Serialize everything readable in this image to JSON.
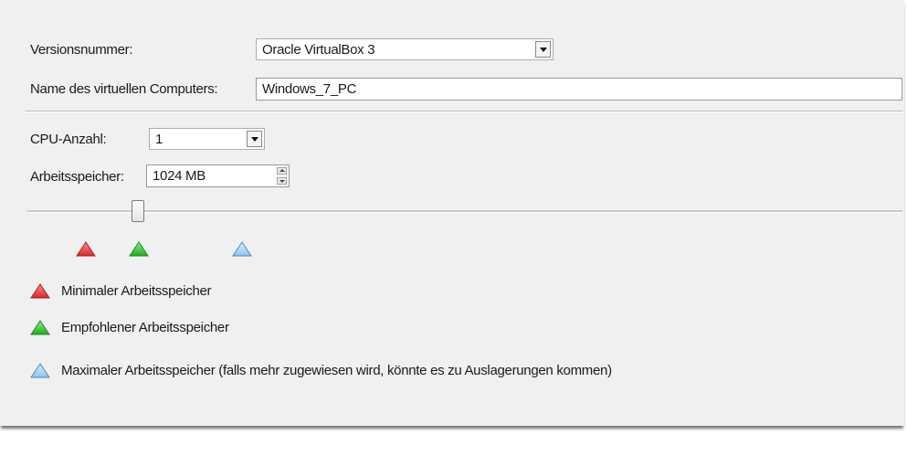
{
  "general": {
    "version_label": "Versionsnummer:",
    "version_value": "Oracle VirtualBox 3",
    "name_label": "Name des virtuellen Computers:",
    "name_value": "Windows_7_PC"
  },
  "hardware": {
    "cpu_label": "CPU-Anzahl:",
    "cpu_value": "1",
    "memory_label": "Arbeitsspeicher:",
    "memory_value": "1024 MB"
  },
  "legend": {
    "min_label": "Minimaler Arbeitsspeicher",
    "recommended_label": "Empfohlener Arbeitsspeicher",
    "max_label": "Maximaler Arbeitsspeicher (falls mehr zugewiesen wird, könnte es zu Auslagerungen kommen)"
  },
  "icons": {
    "min": "red-triangle-icon",
    "recommended": "green-triangle-icon",
    "max": "blue-triangle-icon"
  },
  "colors": {
    "min": "#e04848",
    "recommended": "#3cc43c",
    "max": "#8cc8f0",
    "panel_background": "#f0f0f0"
  }
}
